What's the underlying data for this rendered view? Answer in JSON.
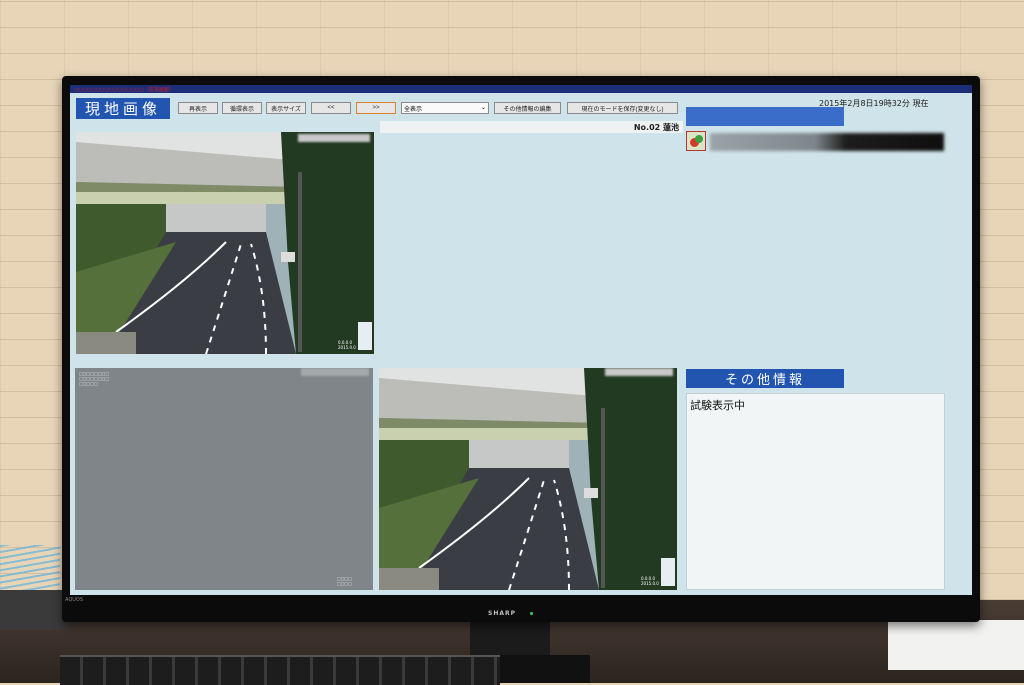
{
  "app": {
    "top_note": "○○○○○○○○○○○○○○○○（監視画面）",
    "title": "現地画像",
    "datetime": "2015年2月8日19時32分 現在"
  },
  "toolbar": {
    "redisplay": "再表示",
    "cycle_display": "循環表示",
    "display_size": "表示サイズ",
    "prev": "<<",
    "next": ">>",
    "view_select_value": "全表示",
    "edit_other_info": "その他情報の編集",
    "save_mode": "現在のモードを保存(変更なし)"
  },
  "cameras": {
    "top_right_label": "No.02 蓮池"
  },
  "camera_osd": {
    "top_left_bottom": "0.0.0.0\n2015.0.0",
    "bottom_left_top": "□□□□□□□□\n□□□□□□□□\n□□□□□",
    "bottom_left_bottom": "□□□□\n□□□□",
    "bottom_right_bottom": "0.0.0.0\n2015.0.0"
  },
  "other_info": {
    "title": "その他情報",
    "text": "試験表示中"
  },
  "bezel": {
    "brand": "SHARP",
    "model": "AQUOS"
  },
  "colors": {
    "title_blue": "#2255b0",
    "screen_bg": "#cfe3ea",
    "accent_orange": "#e0822a"
  }
}
